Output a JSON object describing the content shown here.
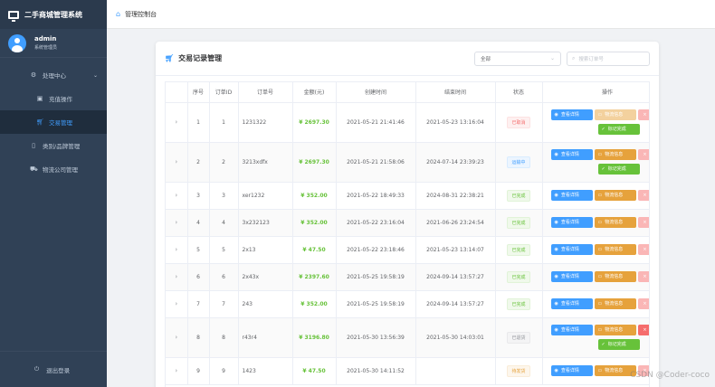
{
  "app": {
    "title": "二手商城管理系统"
  },
  "user": {
    "name": "admin",
    "role": "系统管理员"
  },
  "sidebar": {
    "items": [
      {
        "label": "处理中心"
      },
      {
        "label": "充值操作"
      },
      {
        "label": "交易管理"
      },
      {
        "label": "类别/品牌管理"
      },
      {
        "label": "物流公司管理"
      }
    ],
    "logout": "退出登录"
  },
  "header": {
    "breadcrumb": "管理控制台"
  },
  "card": {
    "title": "交易记录管理",
    "filter": {
      "selected": "全部"
    },
    "search": {
      "placeholder": "搜索订单号"
    }
  },
  "table": {
    "columns": [
      "序号",
      "订单ID",
      "订单号",
      "金额(元)",
      "创建时间",
      "结束时间",
      "状态",
      "操作"
    ],
    "buttons": {
      "detail": "查看详情",
      "logistics": "物流信息",
      "done": "标记完成"
    },
    "rows": [
      {
        "index": "1",
        "id": "1",
        "order_no": "1231322",
        "amount": "¥ 2697.30",
        "created": "2021-05-21 21:41:46",
        "ended": "2021-05-23 13:16:04",
        "status": "已取消"
      },
      {
        "index": "2",
        "id": "2",
        "order_no": "3213xdfx",
        "amount": "¥ 2697.30",
        "created": "2021-05-21 21:58:06",
        "ended": "2024-07-14 23:39:23",
        "status": "运输中"
      },
      {
        "index": "3",
        "id": "3",
        "order_no": "xer1232",
        "amount": "¥ 352.00",
        "created": "2021-05-22 18:49:33",
        "ended": "2024-08-31 22:38:21",
        "status": "已完成"
      },
      {
        "index": "4",
        "id": "4",
        "order_no": "3x232123",
        "amount": "¥ 352.00",
        "created": "2021-05-22 23:16:04",
        "ended": "2021-06-26 23:24:54",
        "status": "已完成"
      },
      {
        "index": "5",
        "id": "5",
        "order_no": "2x13",
        "amount": "¥ 47.50",
        "created": "2021-05-22 23:18:46",
        "ended": "2021-05-23 13:14:07",
        "status": "已完成"
      },
      {
        "index": "6",
        "id": "6",
        "order_no": "2x43x",
        "amount": "¥ 2397.60",
        "created": "2021-05-25 19:58:19",
        "ended": "2024-09-14 13:57:27",
        "status": "已完成"
      },
      {
        "index": "7",
        "id": "7",
        "order_no": "243",
        "amount": "¥ 352.00",
        "created": "2021-05-25 19:58:19",
        "ended": "2024-09-14 13:57:27",
        "status": "已完成"
      },
      {
        "index": "8",
        "id": "8",
        "order_no": "r43r4",
        "amount": "¥ 3196.80",
        "created": "2021-05-30 13:56:39",
        "ended": "2021-05-30 14:03:01",
        "status": "已退货"
      },
      {
        "index": "9",
        "id": "9",
        "order_no": "1423",
        "amount": "¥ 47.50",
        "created": "2021-05-30 14:11:52",
        "ended": "",
        "status": "待发货"
      }
    ]
  },
  "watermark": "CSDN @Coder-coco",
  "colors": {
    "sidebar_bg": "#304156",
    "accent": "#409eff",
    "success": "#67c23a",
    "warning": "#e6a23c",
    "danger": "#f56c6c"
  }
}
